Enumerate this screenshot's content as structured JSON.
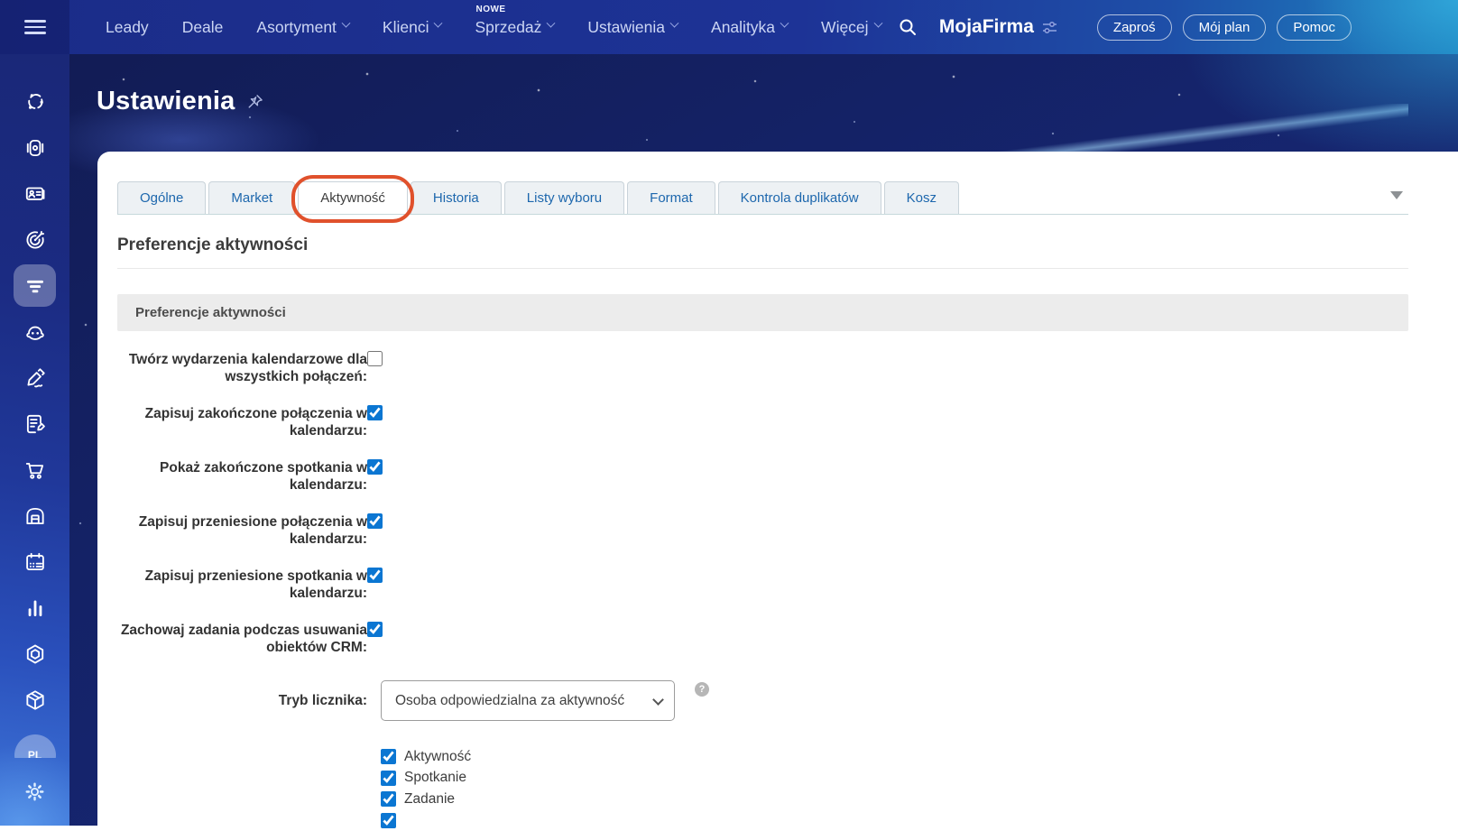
{
  "topnav": {
    "items": [
      {
        "label": "Leady",
        "caret": false
      },
      {
        "label": "Deale",
        "caret": false
      },
      {
        "label": "Asortyment",
        "caret": true
      },
      {
        "label": "Klienci",
        "caret": true
      },
      {
        "label": "Sprzedaż",
        "caret": true,
        "badge": "NOWE"
      },
      {
        "label": "Ustawienia",
        "caret": true
      },
      {
        "label": "Analityka",
        "caret": true
      },
      {
        "label": "Więcej",
        "caret": true
      }
    ],
    "company_name": "MojaFirma",
    "buttons": [
      {
        "label": "Zaproś"
      },
      {
        "label": "Mój plan"
      },
      {
        "label": "Pomoc"
      }
    ]
  },
  "sidebar": {
    "icons": [
      "network",
      "camera",
      "contact-card",
      "target",
      "funnel",
      "robot",
      "signature",
      "document-edit",
      "cart",
      "warehouse",
      "calendar",
      "bar-chart",
      "hexagon",
      "package",
      "pl-badge",
      "settings-gear"
    ],
    "active_icon": "funnel",
    "pl_badge_label": "PL"
  },
  "hero": {
    "title": "Ustawienia"
  },
  "tabs": {
    "items": [
      {
        "label": "Ogólne",
        "active": false
      },
      {
        "label": "Market",
        "active": false
      },
      {
        "label": "Aktywność",
        "active": true,
        "highlighted": true
      },
      {
        "label": "Historia",
        "active": false
      },
      {
        "label": "Listy wyboru",
        "active": false
      },
      {
        "label": "Format",
        "active": false
      },
      {
        "label": "Kontrola duplikatów",
        "active": false
      },
      {
        "label": "Kosz",
        "active": false
      }
    ]
  },
  "content": {
    "heading": "Preferencje aktywności",
    "section_title": "Preferencje aktywności",
    "rows": [
      {
        "label": "Twórz wydarzenia kalendarzowe dla wszystkich połączeń:",
        "checked": false
      },
      {
        "label": "Zapisuj zakończone połączenia w kalendarzu:",
        "checked": true
      },
      {
        "label": "Pokaż zakończone spotkania w kalendarzu:",
        "checked": true
      },
      {
        "label": "Zapisuj przeniesione połączenia w kalendarzu:",
        "checked": true
      },
      {
        "label": "Zapisuj przeniesione spotkania w kalendarzu:",
        "checked": true
      },
      {
        "label": "Zachowaj zadania podczas usuwania obiektów CRM:",
        "checked": true
      }
    ],
    "counter": {
      "label": "Tryb licznika:",
      "value": "Osoba odpowiedzialna za aktywność",
      "help_icon": "?"
    },
    "checkbox_list": [
      {
        "label": "Aktywność",
        "checked": true
      },
      {
        "label": "Spotkanie",
        "checked": true
      },
      {
        "label": "Zadanie",
        "checked": true
      },
      {
        "checked": true
      }
    ]
  },
  "colors": {
    "topbar_blue": "#1d3396",
    "hero_navy": "#15246c",
    "checkbox_accent": "#0b76d2",
    "tab_link_blue": "#1d67ad",
    "annotation_orange": "#e0512c",
    "section_bar_gray": "#ececec"
  }
}
